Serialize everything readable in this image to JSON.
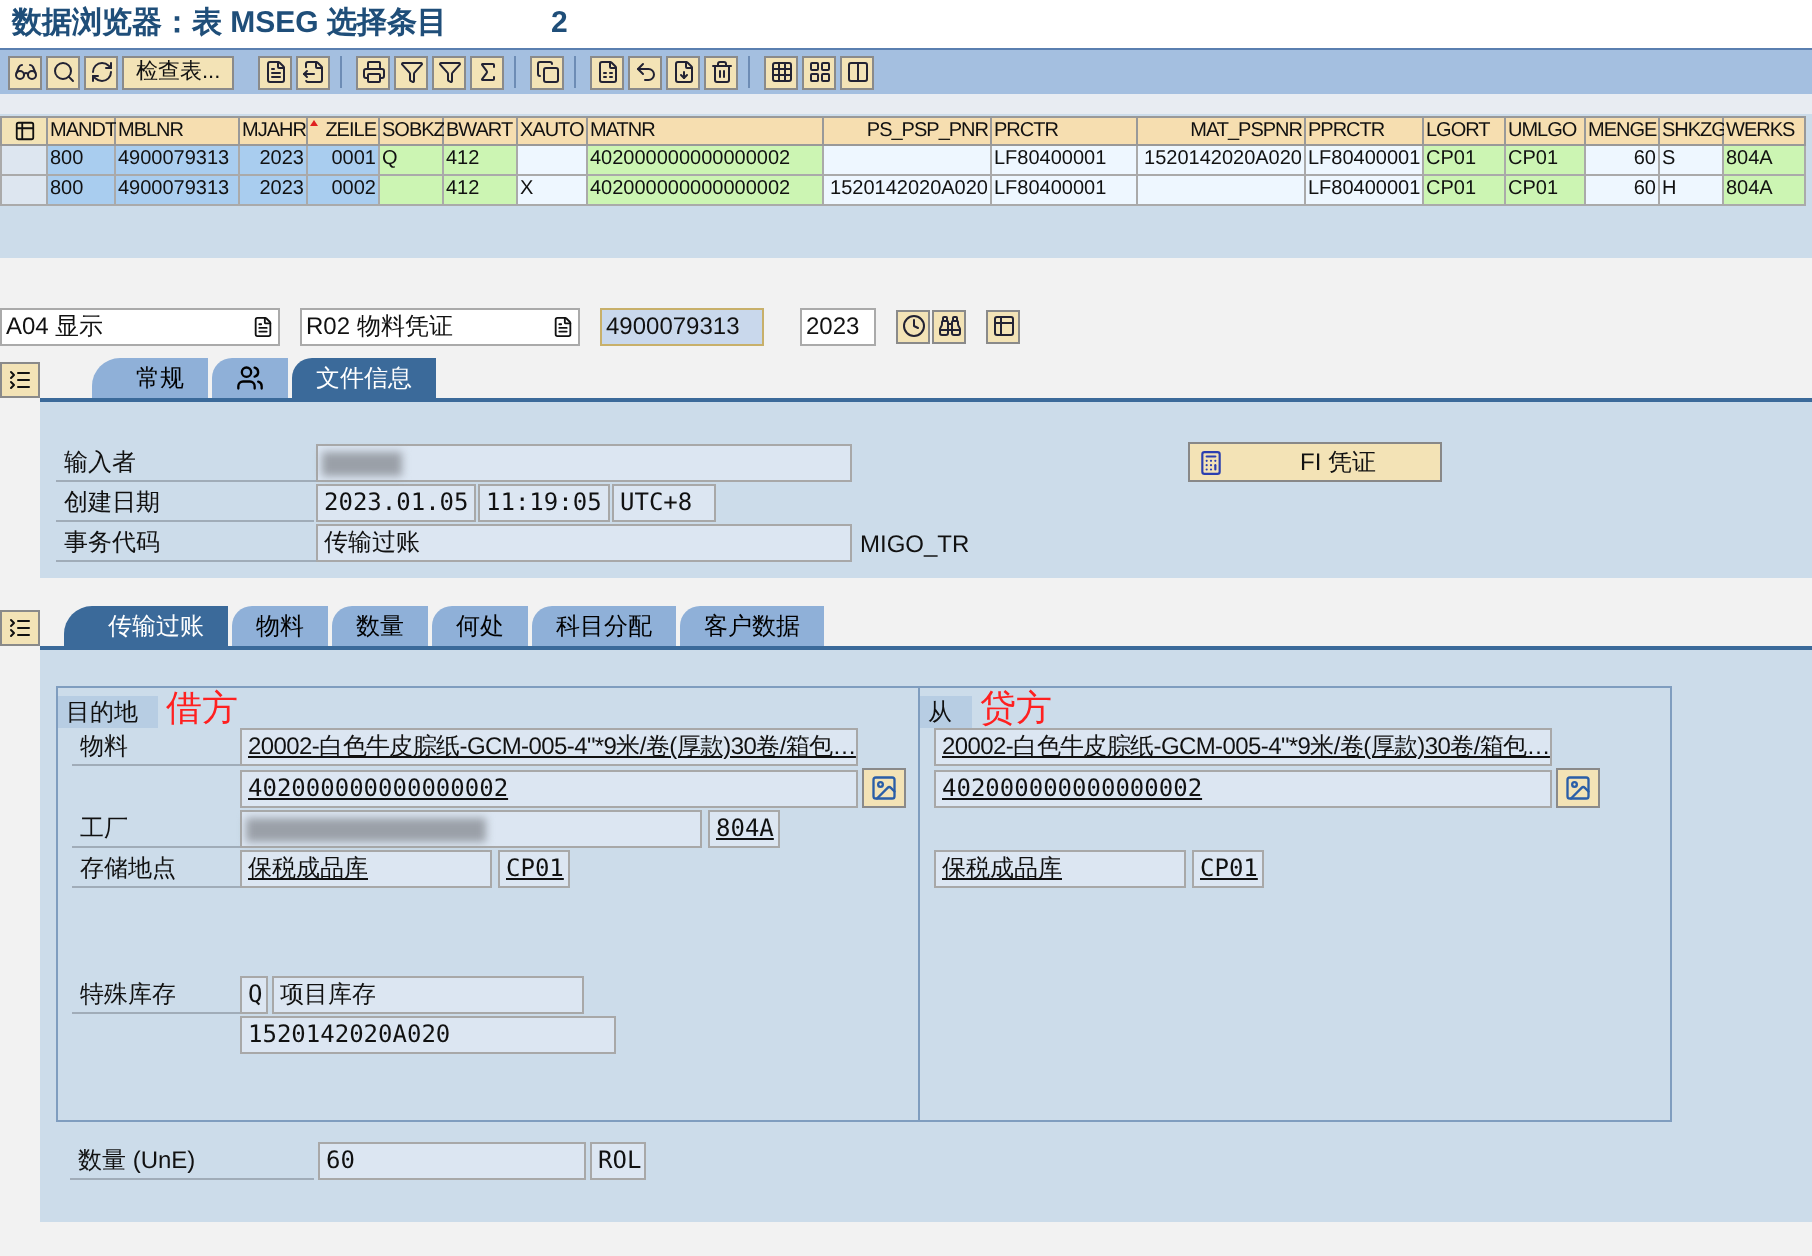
{
  "window": {
    "title": "数据浏览器：表 MSEG 选择条目",
    "count": "2"
  },
  "toolbar": {
    "text_button": "检查表..."
  },
  "table": {
    "columns": [
      {
        "label": "MANDT",
        "kind": "key",
        "sorted": false
      },
      {
        "label": "MBLNR",
        "kind": "key",
        "sorted": false
      },
      {
        "label": "MJAHR",
        "kind": "key",
        "sorted": false
      },
      {
        "label": "ZEILE",
        "kind": "key",
        "sorted": true
      },
      {
        "label": "SOBKZ",
        "kind": "editable",
        "sorted": false
      },
      {
        "label": "BWART",
        "kind": "editable",
        "sorted": false
      },
      {
        "label": "XAUTO",
        "kind": "plain",
        "sorted": false
      },
      {
        "label": "MATNR",
        "kind": "editable",
        "sorted": false
      },
      {
        "label": "PS_PSP_PNR",
        "kind": "plain",
        "sorted": false
      },
      {
        "label": "PRCTR",
        "kind": "plain",
        "sorted": false
      },
      {
        "label": "MAT_PSPNR",
        "kind": "plain",
        "sorted": false
      },
      {
        "label": "PPRCTR",
        "kind": "plain",
        "sorted": false
      },
      {
        "label": "LGORT",
        "kind": "editable",
        "sorted": false
      },
      {
        "label": "UMLGO",
        "kind": "editable",
        "sorted": false
      },
      {
        "label": "MENGE",
        "kind": "plain",
        "sorted": false
      },
      {
        "label": "SHKZG",
        "kind": "plain",
        "sorted": false
      },
      {
        "label": "WERKS",
        "kind": "editable",
        "sorted": false
      }
    ],
    "rows": [
      {
        "cells": [
          "800",
          "4900079313",
          "2023",
          "0001",
          "Q",
          "412",
          "",
          "402000000000000002",
          "",
          "LF80400001",
          "1520142020A020",
          "LF80400001",
          "CP01",
          "CP01",
          "60",
          "S",
          "804A"
        ]
      },
      {
        "cells": [
          "800",
          "4900079313",
          "2023",
          "0002",
          "",
          "412",
          "X",
          "402000000000000002",
          "1520142020A020",
          "LF80400001",
          "",
          "LF80400001",
          "CP01",
          "CP01",
          "60",
          "H",
          "804A"
        ]
      }
    ]
  },
  "selection": {
    "action": "A04 显示",
    "object": "R02 物料凭证",
    "document": "4900079313",
    "year": "2023"
  },
  "header_tabs": [
    {
      "label": "常规",
      "kind": "text",
      "selected": false
    },
    {
      "kind": "icon",
      "selected": false
    },
    {
      "label": "文件信息",
      "kind": "text",
      "selected": true
    }
  ],
  "header": {
    "entered_by_label": "输入者",
    "created_label": "创建日期",
    "created_date": "2023.01.05",
    "created_time": "11:19:05",
    "timezone": "UTC+8",
    "tcode_label": "事务代码",
    "tcode_text": "传输过账",
    "tcode": "MIGO_TR",
    "fi_button": "FI 凭证"
  },
  "item_tabs": [
    {
      "label": "传输过账",
      "selected": true
    },
    {
      "label": "物料",
      "selected": false
    },
    {
      "label": "数量",
      "selected": false
    },
    {
      "label": "何处",
      "selected": false
    },
    {
      "label": "科目分配",
      "selected": false
    },
    {
      "label": "客户数据",
      "selected": false
    }
  ],
  "destination": {
    "title": "目的地",
    "note": "借方",
    "material_label": "物料",
    "material_text": "20002-白色牛皮腙纸-GCM-005-4\"*9米/卷(厚款)30卷/箱包…",
    "material": "402000000000000002",
    "plant_label": "工厂",
    "plant": "804A",
    "sloc_label": "存储地点",
    "sloc_text": "保税成品库",
    "sloc": "CP01",
    "special_label": "特殊库存",
    "special": "Q",
    "special_text": "项目库存",
    "wbs": "1520142020A020"
  },
  "source": {
    "title": "从",
    "note": "贷方",
    "material_text": "20002-白色牛皮腙纸-GCM-005-4\"*9米/卷(厚款)30卷/箱包…",
    "material": "402000000000000002",
    "sloc_text": "保税成品库",
    "sloc": "CP01"
  },
  "quantity": {
    "label": "数量 (UnE)",
    "value": "60",
    "unit": "ROL"
  }
}
